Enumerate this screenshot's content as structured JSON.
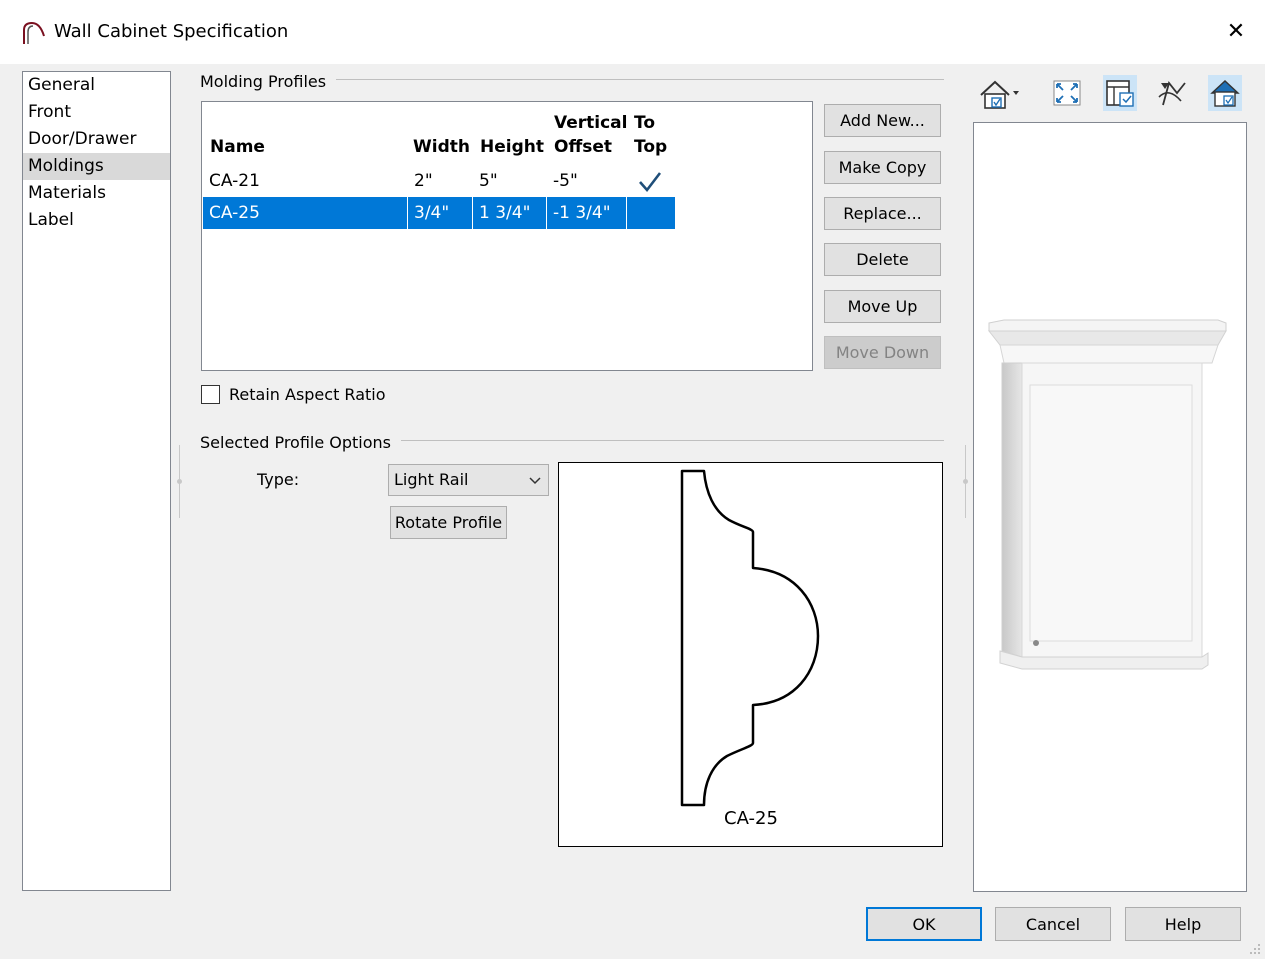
{
  "window": {
    "title": "Wall Cabinet Specification",
    "close_glyph": "✕"
  },
  "nav": {
    "items": [
      {
        "label": "General",
        "selected": false
      },
      {
        "label": "Front",
        "selected": false
      },
      {
        "label": "Door/Drawer",
        "selected": false
      },
      {
        "label": "Moldings",
        "selected": true
      },
      {
        "label": "Materials",
        "selected": false
      },
      {
        "label": "Label",
        "selected": false
      }
    ]
  },
  "molding_profiles": {
    "group_label": "Molding Profiles",
    "columns": {
      "name": "Name",
      "width": "Width",
      "height": "Height",
      "vertical_offset_line1": "Vertical",
      "vertical_offset_line2": "Offset",
      "to_top_line1": "To",
      "to_top_line2": "Top"
    },
    "rows": [
      {
        "name": "CA-21",
        "width": "2\"",
        "height": "5\"",
        "vertical_offset": "-5\"",
        "to_top": true,
        "selected": false
      },
      {
        "name": "CA-25",
        "width": "3/4\"",
        "height": "1 3/4\"",
        "vertical_offset": "-1 3/4\"",
        "to_top": false,
        "selected": true
      }
    ]
  },
  "buttons": {
    "add_new": "Add New...",
    "make_copy": "Make Copy",
    "replace": "Replace...",
    "delete": "Delete",
    "move_up": "Move Up",
    "move_down": "Move Down"
  },
  "retain_aspect_ratio": {
    "label": "Retain Aspect Ratio",
    "checked": false
  },
  "selected_profile": {
    "group_label": "Selected Profile Options",
    "type_label": "Type:",
    "type_value": "Light Rail",
    "rotate_button": "Rotate Profile",
    "preview_name": "CA-25"
  },
  "footer": {
    "ok": "OK",
    "cancel": "Cancel",
    "help": "Help"
  },
  "colors": {
    "selection": "#0078d7",
    "check": "#1f4e79",
    "accent_icon": "#1e6fb5"
  },
  "toolbar_icons": [
    "camera-view-dropdown-icon",
    "fill-window-icon",
    "render-options-icon",
    "orbit-tool-icon",
    "view-settings-icon"
  ]
}
